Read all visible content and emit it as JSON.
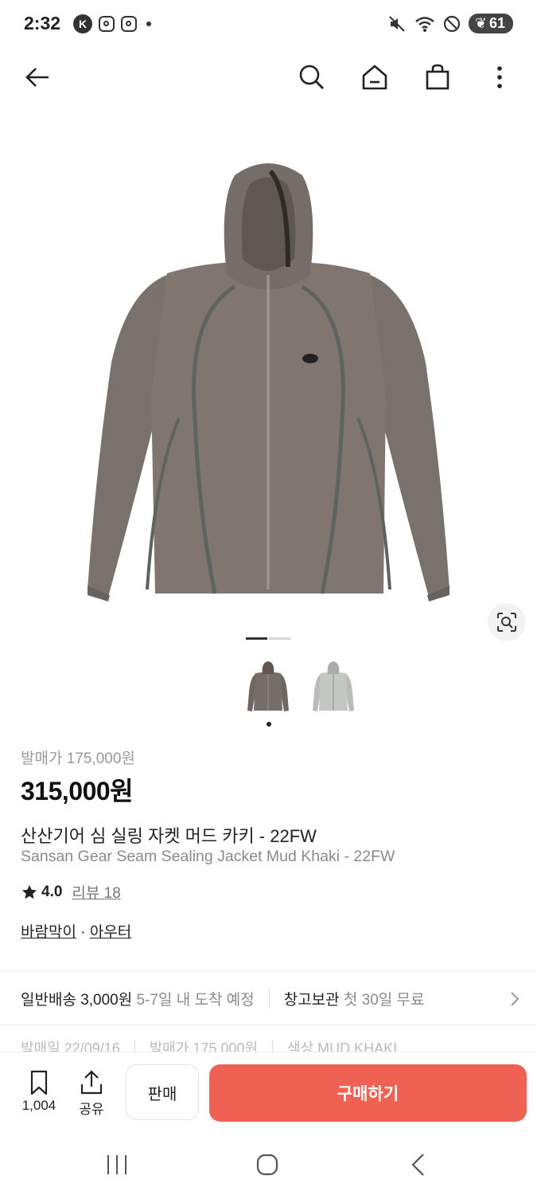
{
  "status_bar": {
    "time": "2:32",
    "badge": "K",
    "battery": "61"
  },
  "app_bar": {
    "icons": [
      "back-arrow-icon",
      "search-icon",
      "home-icon",
      "shopping-bag-icon",
      "more-vertical-icon"
    ]
  },
  "product": {
    "release_price": "발매가 175,000원",
    "price": "315,000원",
    "title_ko": "산산기어 심 실링 자켓 머드 카키 - 22FW",
    "title_en": "Sansan Gear Seam Sealing Jacket Mud Khaki - 22FW",
    "rating": "4.0",
    "reviews": "리뷰 18",
    "category_1": "바람막이",
    "category_sep": " · ",
    "category_2": "아우터",
    "image_count": 2,
    "current_image": 1
  },
  "shipping": {
    "label": "일반배송",
    "fee": "3,000원",
    "eta": "5-7일 내 도착 예정",
    "storage_label": "창고보관",
    "storage_detail": "첫 30일 무료"
  },
  "info_row": {
    "release_date": "발매일 22/09/16",
    "release_price": "발매가 175,000원",
    "color": "색상 MUD KHAKI"
  },
  "bottom_bar": {
    "bookmark_count": "1,004",
    "share_label": "공유",
    "sell_label": "판매",
    "buy_label": "구매하기"
  },
  "colors": {
    "buy_button": "#ef6253",
    "jacket": "#7a716c"
  }
}
